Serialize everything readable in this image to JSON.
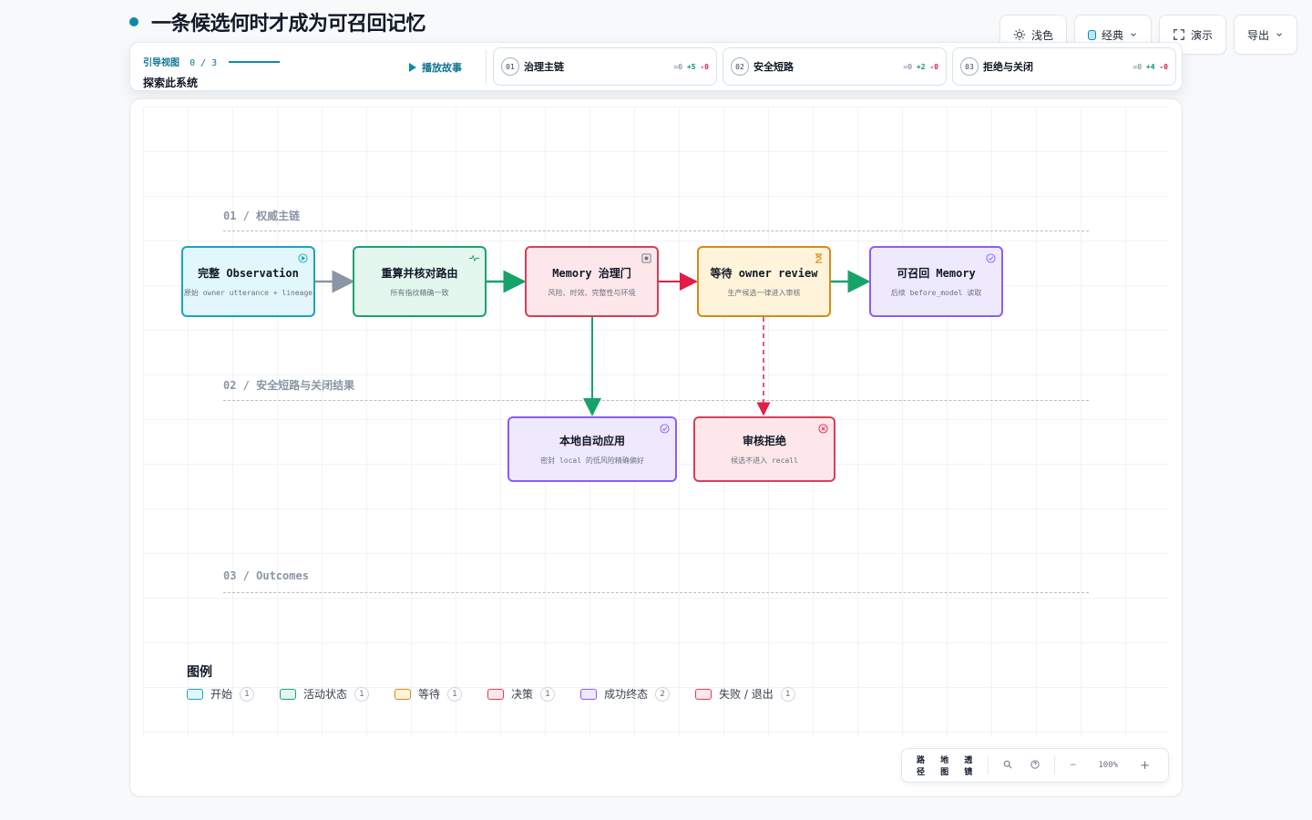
{
  "title": "一条候选何时才成为可召回记忆",
  "toolbar": {
    "theme_label": "浅色",
    "style_label": "经典",
    "present_label": "演示",
    "export_label": "导出"
  },
  "guide": {
    "label": "引导视图",
    "progress": "0 / 3",
    "subtitle": "探索此系统",
    "play_label": "播放故事",
    "chapters": [
      {
        "num": "01",
        "title": "治理主链",
        "eq": "=0",
        "plus": "+5",
        "minus": "-0"
      },
      {
        "num": "02",
        "title": "安全短路",
        "eq": "=0",
        "plus": "+2",
        "minus": "-0"
      },
      {
        "num": "03",
        "title": "拒绝与关闭",
        "eq": "=0",
        "plus": "+4",
        "minus": "-0"
      }
    ]
  },
  "lanes": [
    {
      "label": "01 / 权威主链"
    },
    {
      "label": "02 / 安全短路与关闭结果"
    },
    {
      "label": "03 / Outcomes"
    }
  ],
  "nodes": {
    "observation": {
      "title": "完整 Observation",
      "sub": "原始 owner utterance + lineage"
    },
    "recompute": {
      "title": "重算并核对路由",
      "sub": "所有指纹精确一致"
    },
    "gate": {
      "title": "Memory 治理门",
      "sub": "风险、时效、完整性与环境"
    },
    "review": {
      "title": "等待 owner review",
      "sub": "生产候选一律进入审核"
    },
    "recallable": {
      "title": "可召回 Memory",
      "sub": "后续 before_model 读取"
    },
    "auto_apply": {
      "title": "本地自动应用",
      "sub": "密封 local 的低风险精确偏好"
    },
    "rejected": {
      "title": "审核拒绝",
      "sub": "候选不进入 recall"
    }
  },
  "legend": {
    "title": "图例",
    "items": [
      {
        "label": "开始",
        "count": "1",
        "fill": "#e2f7fb",
        "stroke": "#1aa3bf"
      },
      {
        "label": "活动状态",
        "count": "1",
        "fill": "#e3f7ee",
        "stroke": "#1aa36f"
      },
      {
        "label": "等待",
        "count": "1",
        "fill": "#fff4d9",
        "stroke": "#d48a1a"
      },
      {
        "label": "决策",
        "count": "1",
        "fill": "#fde7ea",
        "stroke": "#d6405a"
      },
      {
        "label": "成功终态",
        "count": "2",
        "fill": "#efe9fd",
        "stroke": "#8b5cf6"
      },
      {
        "label": "失败 / 退出",
        "count": "1",
        "fill": "#fde7ea",
        "stroke": "#d6405a"
      }
    ]
  },
  "controls": {
    "path": "路径",
    "map": "地图",
    "lens": "透镜",
    "zoom": "100%",
    "minus": "−",
    "plus": "+"
  },
  "colors": {
    "accent": "#0e8aa8",
    "edge_green": "#16a36a",
    "edge_red": "#e11d48",
    "edge_gray": "#8b95a5"
  }
}
